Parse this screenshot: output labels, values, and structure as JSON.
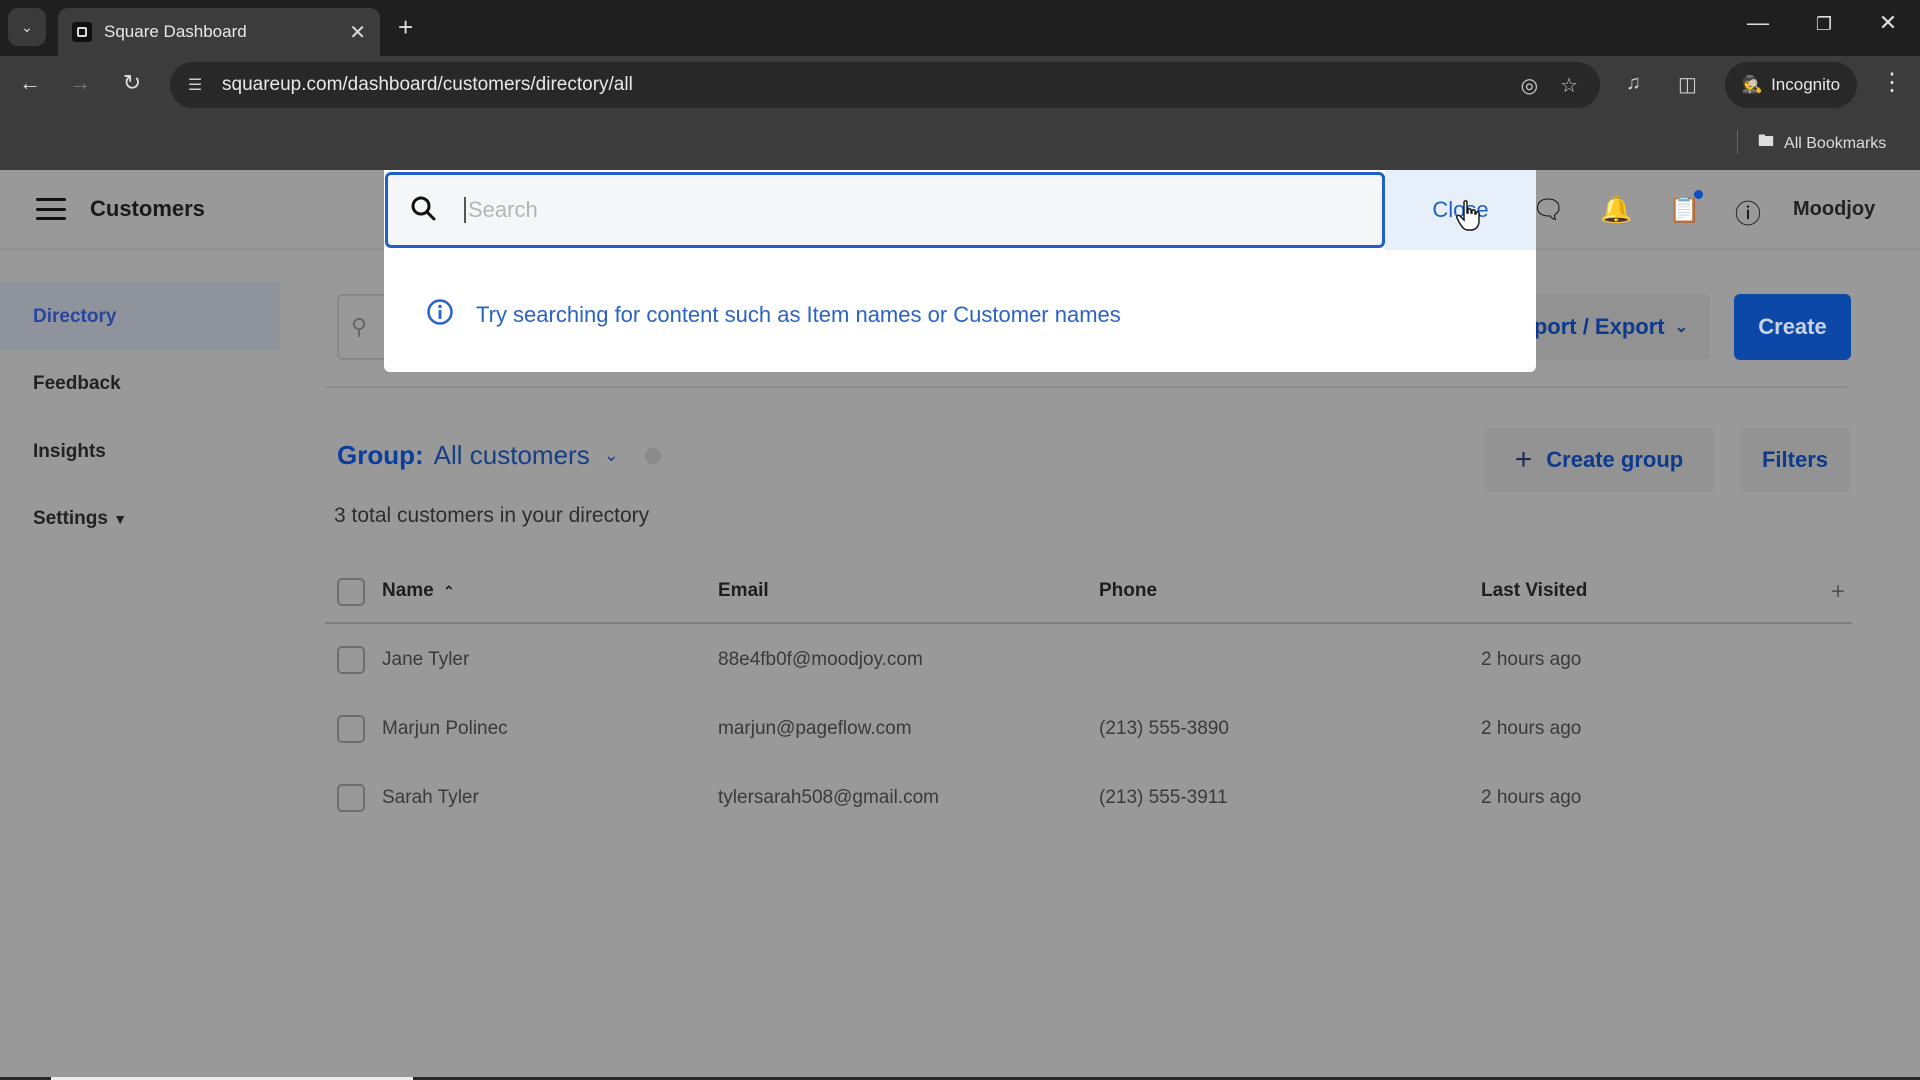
{
  "browser": {
    "tab_title": "Square Dashboard",
    "url": "squareup.com/dashboard/customers/directory/all",
    "incognito_label": "Incognito",
    "bookmarks_label": "All Bookmarks"
  },
  "header": {
    "title": "Customers",
    "account_name": "Moodjoy",
    "icons": [
      "messages-icon",
      "bell-icon",
      "clipboard-icon",
      "help-icon"
    ]
  },
  "sidebar": {
    "items": [
      {
        "label": "Directory",
        "active": true
      },
      {
        "label": "Feedback"
      },
      {
        "label": "Insights"
      },
      {
        "label": "Settings",
        "has_dropdown": true
      }
    ]
  },
  "search": {
    "placeholder": "Search",
    "value": "",
    "close_label": "Close",
    "hint": "Try searching for content such as Item names or Customer names"
  },
  "actions": {
    "import_export_label": "Import / Export",
    "create_label": "Create",
    "create_group_label": "Create group",
    "filters_label": "Filters"
  },
  "group": {
    "label": "Group:",
    "value": "All customers"
  },
  "summary": "3 total customers in your directory",
  "table": {
    "columns": [
      "Name",
      "Email",
      "Phone",
      "Last Visited"
    ],
    "sort": {
      "column": "Name",
      "direction": "asc"
    },
    "rows": [
      {
        "name": "Jane Tyler",
        "email": "88e4fb0f@moodjoy.com",
        "phone": "",
        "last_visited": "2 hours ago"
      },
      {
        "name": "Marjun Polinec",
        "email": "marjun@pageflow.com",
        "phone": "(213) 555-3890",
        "last_visited": "2 hours ago"
      },
      {
        "name": "Sarah Tyler",
        "email": "tylersarah508@gmail.com",
        "phone": "(213) 555-3911",
        "last_visited": "2 hours ago"
      }
    ]
  },
  "colors": {
    "accent": "#1f5fc6",
    "primary_button": "#0b48a8",
    "close_area_bg": "#e7effb",
    "overlay": "#999999"
  }
}
